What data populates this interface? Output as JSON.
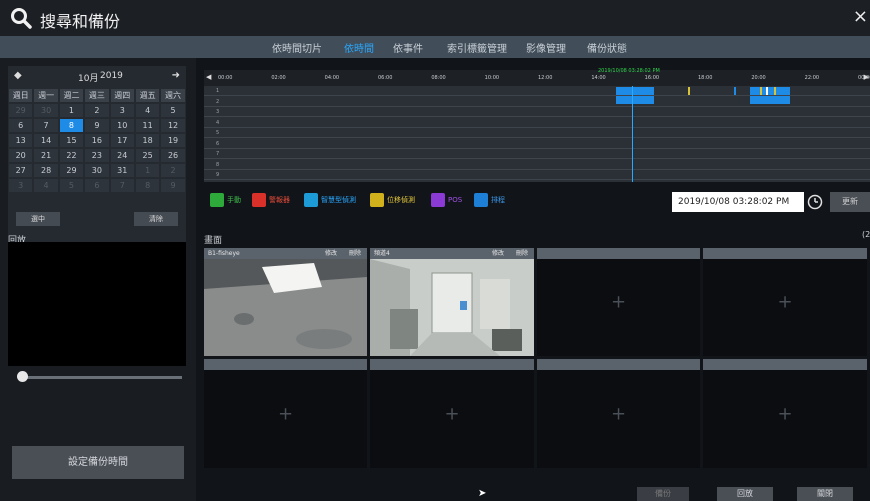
{
  "title": "搜尋和備份",
  "tabs": [
    "依時間切片",
    "依時間",
    "依事件",
    "索引標籤管理",
    "影像管理",
    "備份狀態"
  ],
  "calendar": {
    "month": "10月",
    "year": "2019",
    "weekdays": [
      "週日",
      "週一",
      "週二",
      "週三",
      "週四",
      "週五",
      "週六"
    ],
    "weeks": [
      [
        "29",
        "30",
        "1",
        "2",
        "3",
        "4",
        "5"
      ],
      [
        "6",
        "7",
        "8",
        "9",
        "10",
        "11",
        "12"
      ],
      [
        "13",
        "14",
        "15",
        "16",
        "17",
        "18",
        "19"
      ],
      [
        "20",
        "21",
        "22",
        "23",
        "24",
        "25",
        "26"
      ],
      [
        "27",
        "28",
        "29",
        "30",
        "31",
        "1",
        "2"
      ],
      [
        "3",
        "4",
        "5",
        "6",
        "7",
        "8",
        "9"
      ]
    ],
    "selected_day": "8",
    "select_all": "選中",
    "clear": "清除"
  },
  "playback": {
    "label": "回放",
    "backup_time_button": "設定備份時間"
  },
  "timeline": {
    "ticks": [
      "00:00",
      "02:00",
      "04:00",
      "06:00",
      "08:00",
      "10:00",
      "12:00",
      "14:00",
      "16:00",
      "18:00",
      "20:00",
      "22:00",
      "00:00"
    ],
    "cursor_time": "2019/10/08 03:28:02 PM",
    "tracks": [
      "1",
      "2",
      "3",
      "4",
      "5",
      "6",
      "7",
      "8",
      "9"
    ]
  },
  "legend": [
    {
      "label": "手動",
      "color": "#2eaa3a",
      "text": "#3fbf4c",
      "icon": "hand-icon"
    },
    {
      "label": "警報器",
      "color": "#d9302a",
      "text": "#e04a3a",
      "icon": "alarm-icon"
    },
    {
      "label": "智慧型偵測",
      "color": "#1c9bd6",
      "text": "#29a8ff",
      "icon": "smart-detection-icon"
    },
    {
      "label": "位移偵測",
      "color": "#d2b21c",
      "text": "#e2c63a",
      "icon": "motion-icon"
    },
    {
      "label": "POS",
      "color": "#8b3ad6",
      "text": "#a050e6",
      "icon": "pos-icon"
    },
    {
      "label": "排程",
      "color": "#1e7fd6",
      "text": "#3a98ec",
      "icon": "schedule-icon"
    }
  ],
  "datetime_value": "2019/10/08 03:28:02 PM",
  "refresh_label": "更新",
  "screen_label": "畫面",
  "count_label": "(2",
  "panes": [
    {
      "name": "B1-fisheye",
      "edit": "修改",
      "del": "刪除"
    },
    {
      "name": "頻道4",
      "edit": "修改",
      "del": "刪除"
    }
  ],
  "bottom": {
    "backup": "備份",
    "playback": "回放",
    "close": "關閉"
  }
}
